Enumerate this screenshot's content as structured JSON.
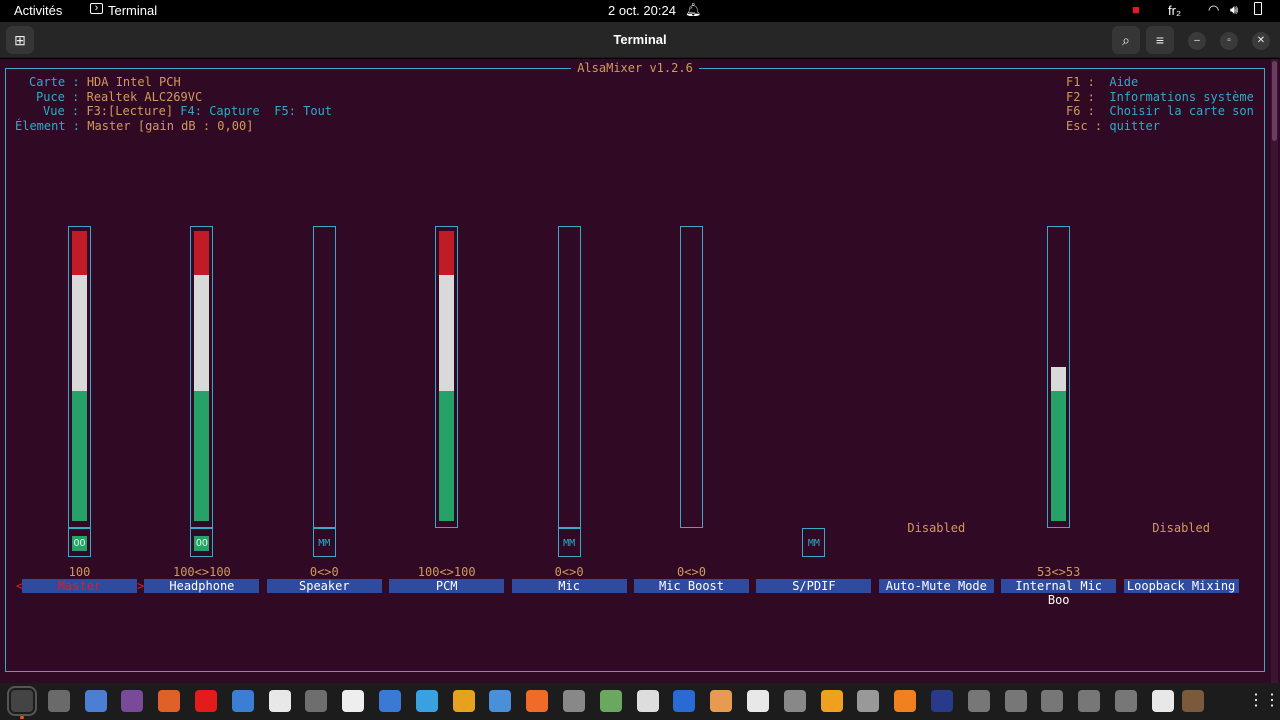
{
  "topbar": {
    "activities": "Activités",
    "app_name": "Terminal",
    "clock": "2 oct.  20:24",
    "keyboard_layout": "fr₂"
  },
  "window": {
    "title": "Terminal"
  },
  "alsamixer": {
    "version_title": "AlsaMixer v1.2.6",
    "info": {
      "card_label": "Carte :",
      "card_value": "HDA Intel PCH",
      "chip_label": "Puce :",
      "chip_value": "Realtek ALC269VC",
      "view_label": "Vue :",
      "view_value_f3": "F3:[Lecture]",
      "view_value_f4": "F4: Capture",
      "view_value_f5": "F5: Tout",
      "element_label": "Élement :",
      "element_value": "Master [gain dB : 0,00]"
    },
    "help": {
      "f1_key": "F1 :",
      "f1_text": "Aide",
      "f2_key": "F2 :",
      "f2_text": "Informations système",
      "f6_key": "F6 :",
      "f6_text": "Choisir la carte son",
      "esc_key": "Esc :",
      "esc_text": "quitter"
    },
    "channels": [
      {
        "name": "Master",
        "volume": "100",
        "mute": "OO",
        "level": 100,
        "selected": true
      },
      {
        "name": "Headphone",
        "volume": "100<>100",
        "mute": "OO",
        "level": 100
      },
      {
        "name": "Speaker",
        "volume": "0<>0",
        "mute": "MM",
        "level": 0
      },
      {
        "name": "PCM",
        "volume": "100<>100",
        "mute": "",
        "level": 100
      },
      {
        "name": "Mic",
        "volume": "0<>0",
        "mute": "MM",
        "level": 0
      },
      {
        "name": "Mic Boost",
        "volume": "0<>0",
        "mute": "",
        "level": 0
      },
      {
        "name": "S/PDIF",
        "volume": "",
        "mute": "MM",
        "level": null
      },
      {
        "name": "Auto-Mute Mode",
        "volume": "",
        "status": "Disabled"
      },
      {
        "name": "Internal Mic Boo",
        "volume": "53<>53",
        "mute": "",
        "level": 53
      },
      {
        "name": "Loopback Mixing",
        "volume": "",
        "status": "Disabled"
      }
    ]
  },
  "colors": {
    "terminal_bg": "#300a24",
    "frame": "#3aa9c8",
    "label_cyan": "#2fa9c9",
    "value_orange": "#d09a5a",
    "meter_green": "#26a269",
    "meter_white": "#d9d9d9",
    "meter_red": "#c01c28",
    "name_bg": "#2f4ba0"
  },
  "dock": {
    "icons": [
      "terminal-icon",
      "files-icon",
      "screenshot-icon",
      "video-editor-icon",
      "presentation-icon",
      "youtube-icon",
      "document-icon",
      "pdf-icon",
      "software-updater-icon",
      "terminal-web-icon",
      "settings-icon",
      "help-icon",
      "chrome-icon",
      "chromium-icon",
      "brave-icon",
      "usb-icon",
      "disks-icon",
      "mail-icon",
      "text-editor-icon",
      "archive-icon",
      "x-icon",
      "usb-drive-icon",
      "vlc-alt-icon",
      "camera-icon",
      "vlc-icon",
      "mixer-icon",
      "drive-1-icon",
      "drive-2-icon",
      "drive-3-icon",
      "drive-4-icon",
      "drive-5-icon",
      "trash-icon",
      "logo-icon",
      "app-grid-icon"
    ]
  }
}
